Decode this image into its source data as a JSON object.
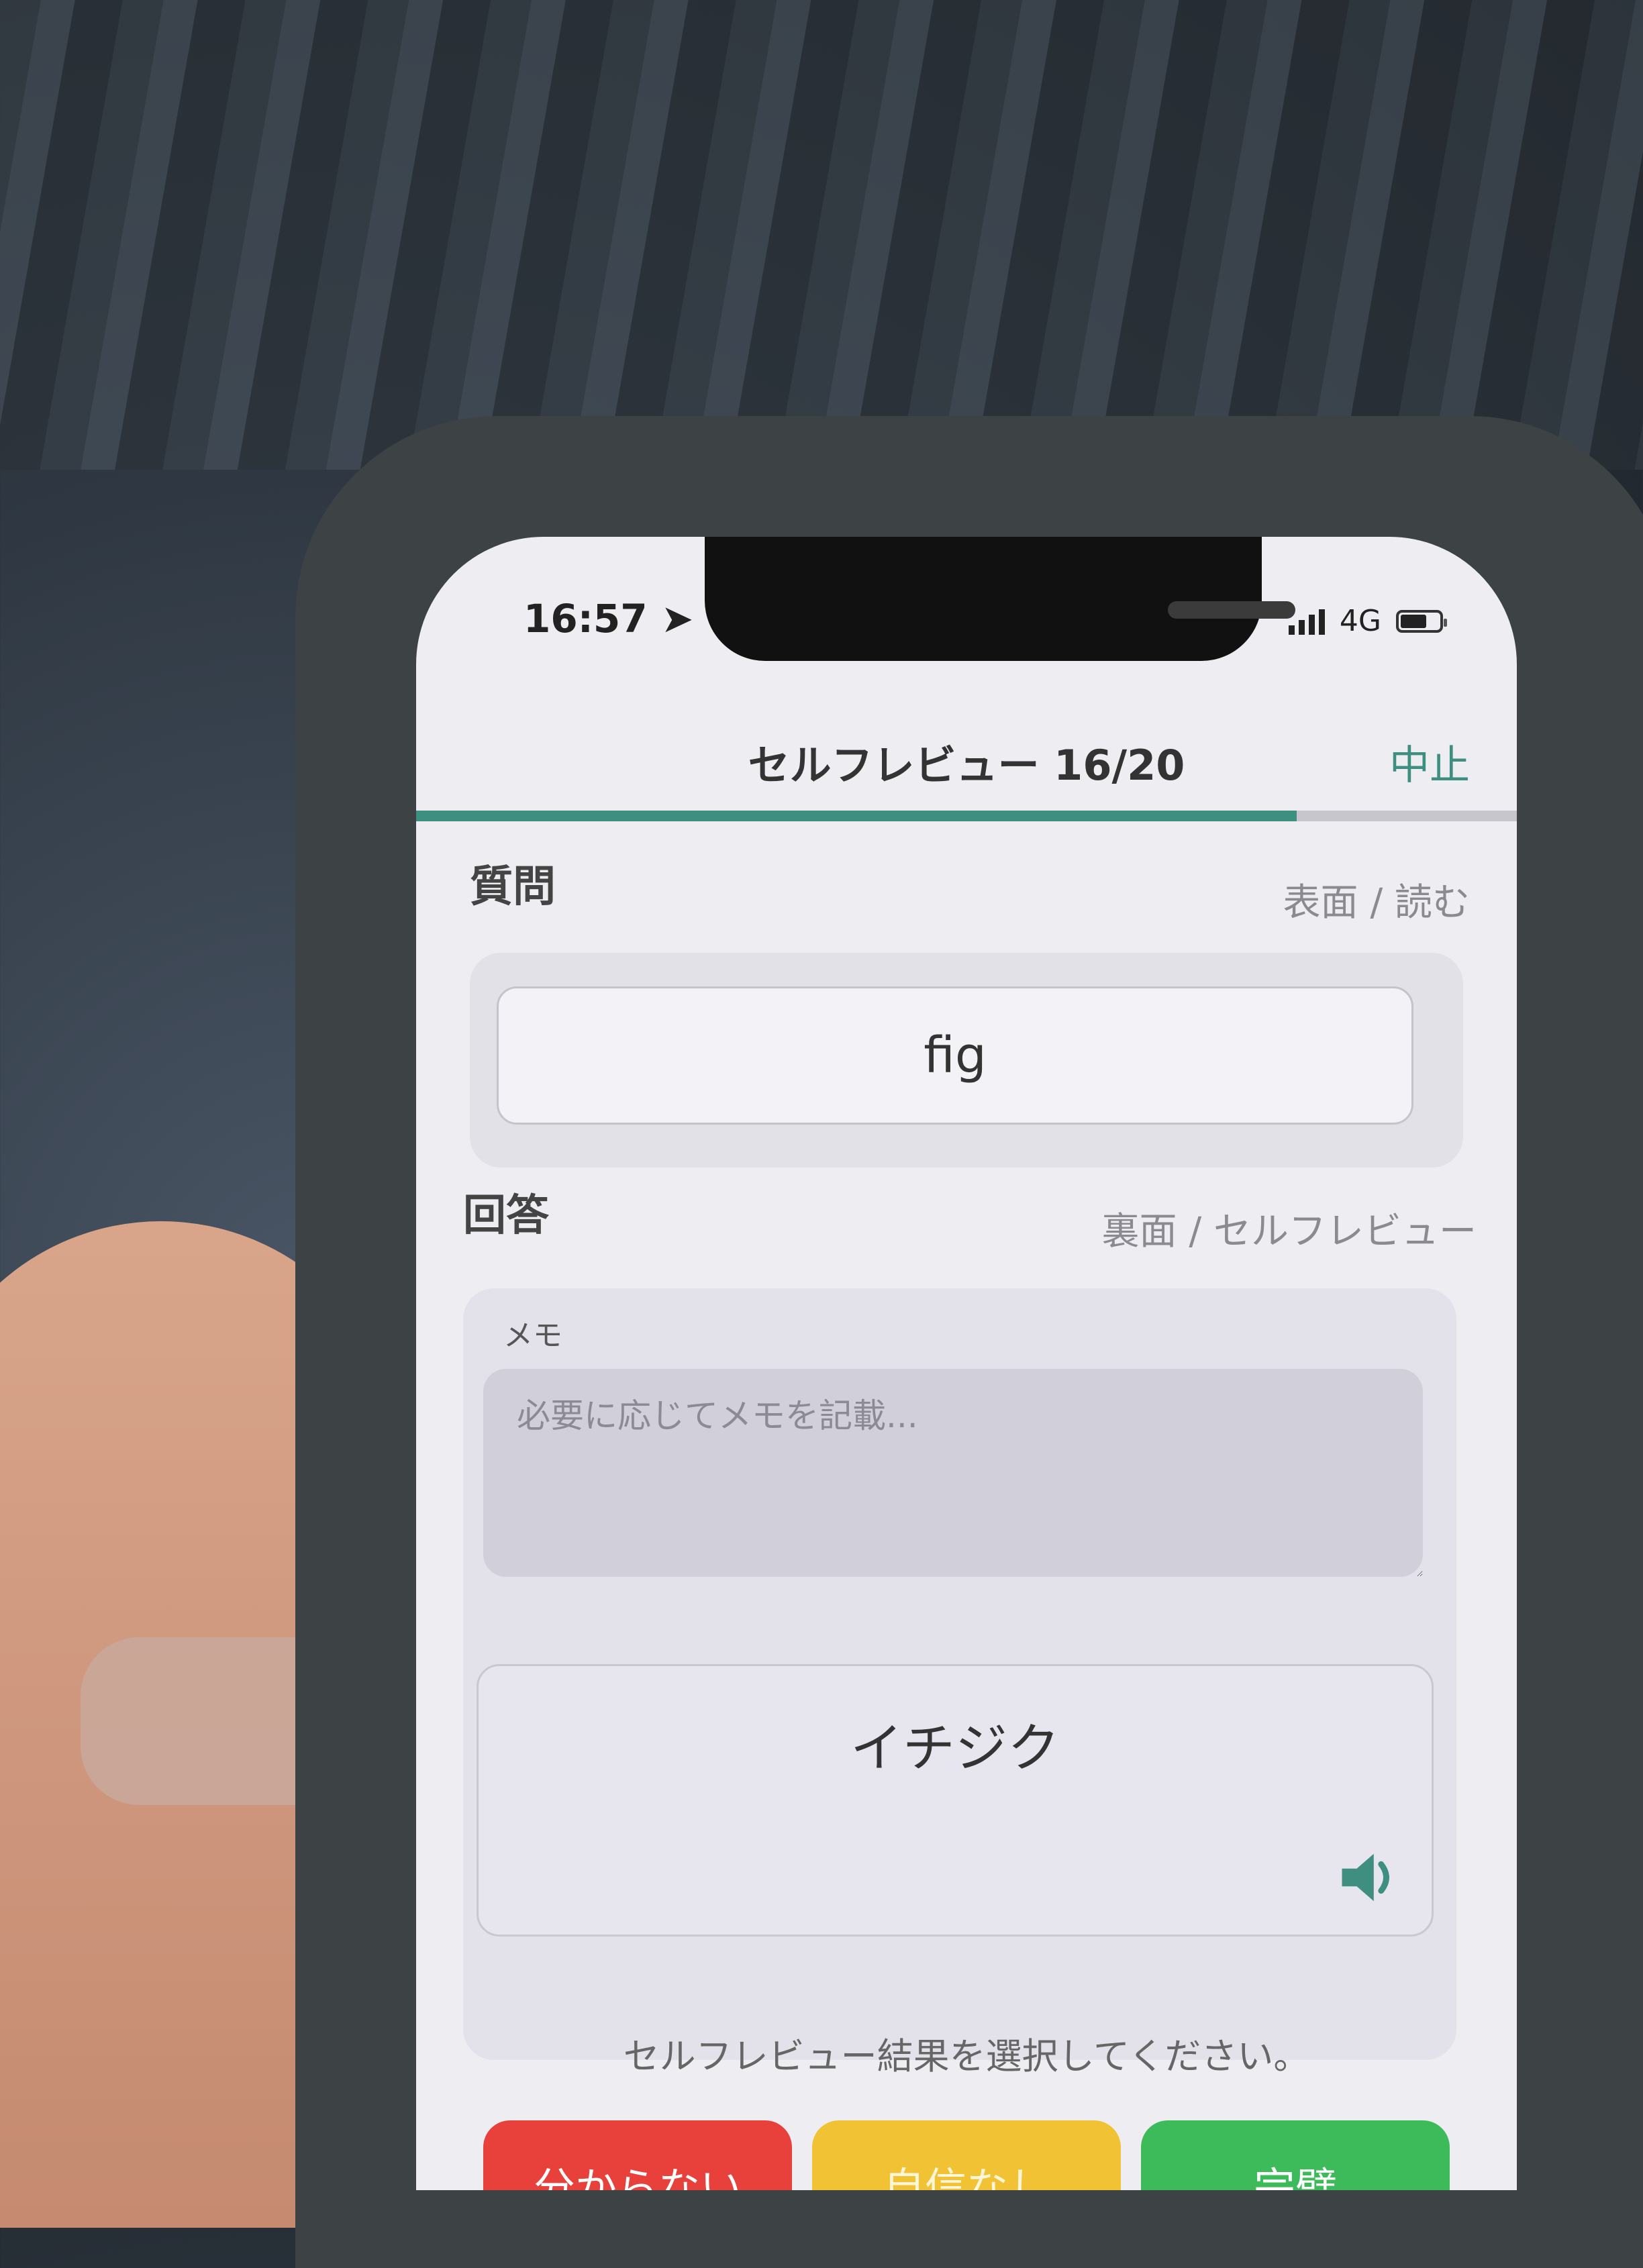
{
  "status_bar": {
    "time": "16:57",
    "network": "4G"
  },
  "nav": {
    "title": "セルフレビュー 16/20",
    "stop_label": "中止"
  },
  "progress": {
    "current": 16,
    "total": 20,
    "fraction": 0.8
  },
  "question": {
    "label": "質問",
    "meta": "表面 / 読む",
    "text": "fig"
  },
  "answer": {
    "label": "回答",
    "meta": "裏面 / セルフレビュー",
    "memo_label": "メモ",
    "memo_placeholder": "必要に応じてメモを記載...",
    "text": "イチジク",
    "audio_icon": "speaker-icon"
  },
  "instruction": "セルフレビュー結果を選択してください。",
  "buttons": {
    "unknown": "分からない",
    "unsure": "自信なし",
    "perfect": "完璧"
  },
  "colors": {
    "accent": "#3f8f80",
    "red": "#e8413c",
    "yellow": "#f1c233",
    "green": "#3dbb5a"
  }
}
